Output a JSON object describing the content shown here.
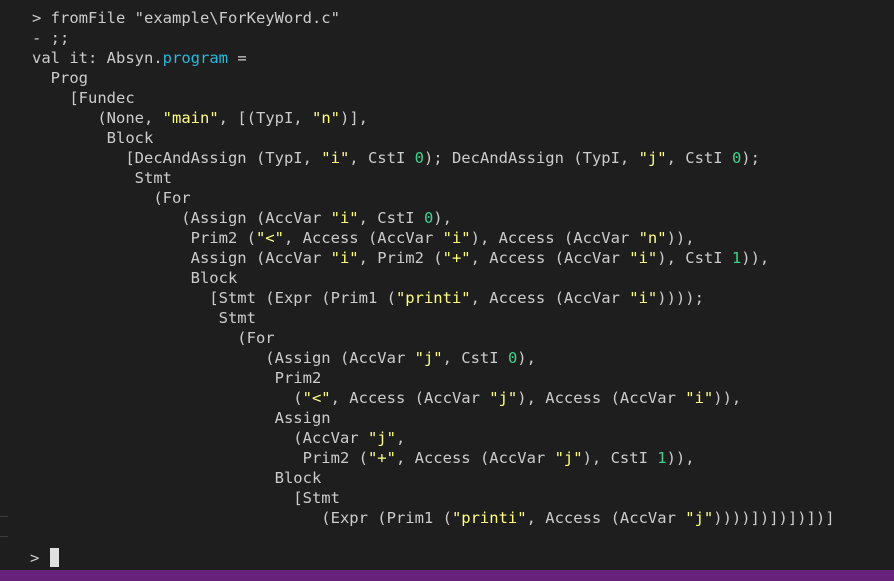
{
  "colors": {
    "background": "#1e1e1e",
    "text": "#cccccc",
    "string": "#ffff80",
    "number": "#3fd18a",
    "type": "#29b8db",
    "statusbar": "#68217a",
    "cursor": "#e0e0e0"
  },
  "terminal": {
    "prompt_line": [
      {
        "t": "> fromFile "
      },
      {
        "t": "\"example\\ForKeyWord.c\""
      }
    ],
    "lines": [
      [
        {
          "t": "- ;;"
        }
      ],
      [
        {
          "t": "val it: Absyn."
        },
        {
          "t": "program",
          "c": "typ"
        },
        {
          "t": " ="
        }
      ],
      [
        {
          "t": "  Prog"
        }
      ],
      [
        {
          "t": "    [Fundec"
        }
      ],
      [
        {
          "t": "       (None, "
        },
        {
          "t": "\"main\"",
          "c": "str"
        },
        {
          "t": ", [(TypI, "
        },
        {
          "t": "\"n\"",
          "c": "str"
        },
        {
          "t": ")],"
        }
      ],
      [
        {
          "t": "        Block"
        }
      ],
      [
        {
          "t": "          [DecAndAssign (TypI, "
        },
        {
          "t": "\"i\"",
          "c": "str"
        },
        {
          "t": ", CstI "
        },
        {
          "t": "0",
          "c": "num"
        },
        {
          "t": "); DecAndAssign (TypI, "
        },
        {
          "t": "\"j\"",
          "c": "str"
        },
        {
          "t": ", CstI "
        },
        {
          "t": "0",
          "c": "num"
        },
        {
          "t": ");"
        }
      ],
      [
        {
          "t": "           Stmt"
        }
      ],
      [
        {
          "t": "             (For"
        }
      ],
      [
        {
          "t": "                (Assign (AccVar "
        },
        {
          "t": "\"i\"",
          "c": "str"
        },
        {
          "t": ", CstI "
        },
        {
          "t": "0",
          "c": "num"
        },
        {
          "t": "),"
        }
      ],
      [
        {
          "t": "                 Prim2 ("
        },
        {
          "t": "\"<\"",
          "c": "str"
        },
        {
          "t": ", Access (AccVar "
        },
        {
          "t": "\"i\"",
          "c": "str"
        },
        {
          "t": "), Access (AccVar "
        },
        {
          "t": "\"n\"",
          "c": "str"
        },
        {
          "t": ")),"
        }
      ],
      [
        {
          "t": "                 Assign (AccVar "
        },
        {
          "t": "\"i\"",
          "c": "str"
        },
        {
          "t": ", Prim2 ("
        },
        {
          "t": "\"+\"",
          "c": "str"
        },
        {
          "t": ", Access (AccVar "
        },
        {
          "t": "\"i\"",
          "c": "str"
        },
        {
          "t": "), CstI "
        },
        {
          "t": "1",
          "c": "num"
        },
        {
          "t": ")),"
        }
      ],
      [
        {
          "t": "                 Block"
        }
      ],
      [
        {
          "t": "                   [Stmt (Expr (Prim1 ("
        },
        {
          "t": "\"printi\"",
          "c": "str"
        },
        {
          "t": ", Access (AccVar "
        },
        {
          "t": "\"i\"",
          "c": "str"
        },
        {
          "t": "))));"
        }
      ],
      [
        {
          "t": "                    Stmt"
        }
      ],
      [
        {
          "t": "                      (For"
        }
      ],
      [
        {
          "t": "                         (Assign (AccVar "
        },
        {
          "t": "\"j\"",
          "c": "str"
        },
        {
          "t": ", CstI "
        },
        {
          "t": "0",
          "c": "num"
        },
        {
          "t": "),"
        }
      ],
      [
        {
          "t": "                          Prim2"
        }
      ],
      [
        {
          "t": "                            ("
        },
        {
          "t": "\"<\"",
          "c": "str"
        },
        {
          "t": ", Access (AccVar "
        },
        {
          "t": "\"j\"",
          "c": "str"
        },
        {
          "t": "), Access (AccVar "
        },
        {
          "t": "\"i\"",
          "c": "str"
        },
        {
          "t": ")),"
        }
      ],
      [
        {
          "t": "                          Assign"
        }
      ],
      [
        {
          "t": "                            (AccVar "
        },
        {
          "t": "\"j\"",
          "c": "str"
        },
        {
          "t": ","
        }
      ],
      [
        {
          "t": "                             Prim2 ("
        },
        {
          "t": "\"+\"",
          "c": "str"
        },
        {
          "t": ", Access (AccVar "
        },
        {
          "t": "\"j\"",
          "c": "str"
        },
        {
          "t": "), CstI "
        },
        {
          "t": "1",
          "c": "num"
        },
        {
          "t": ")),"
        }
      ],
      [
        {
          "t": "                          Block"
        }
      ],
      [
        {
          "t": "                            [Stmt"
        }
      ],
      [
        {
          "t": "                               (Expr (Prim1 ("
        },
        {
          "t": "\"printi\"",
          "c": "str"
        },
        {
          "t": ", Access (AccVar "
        },
        {
          "t": "\"j\"",
          "c": "str"
        },
        {
          "t": "))))])])])])]"
        }
      ]
    ],
    "input_prompt": "> "
  }
}
